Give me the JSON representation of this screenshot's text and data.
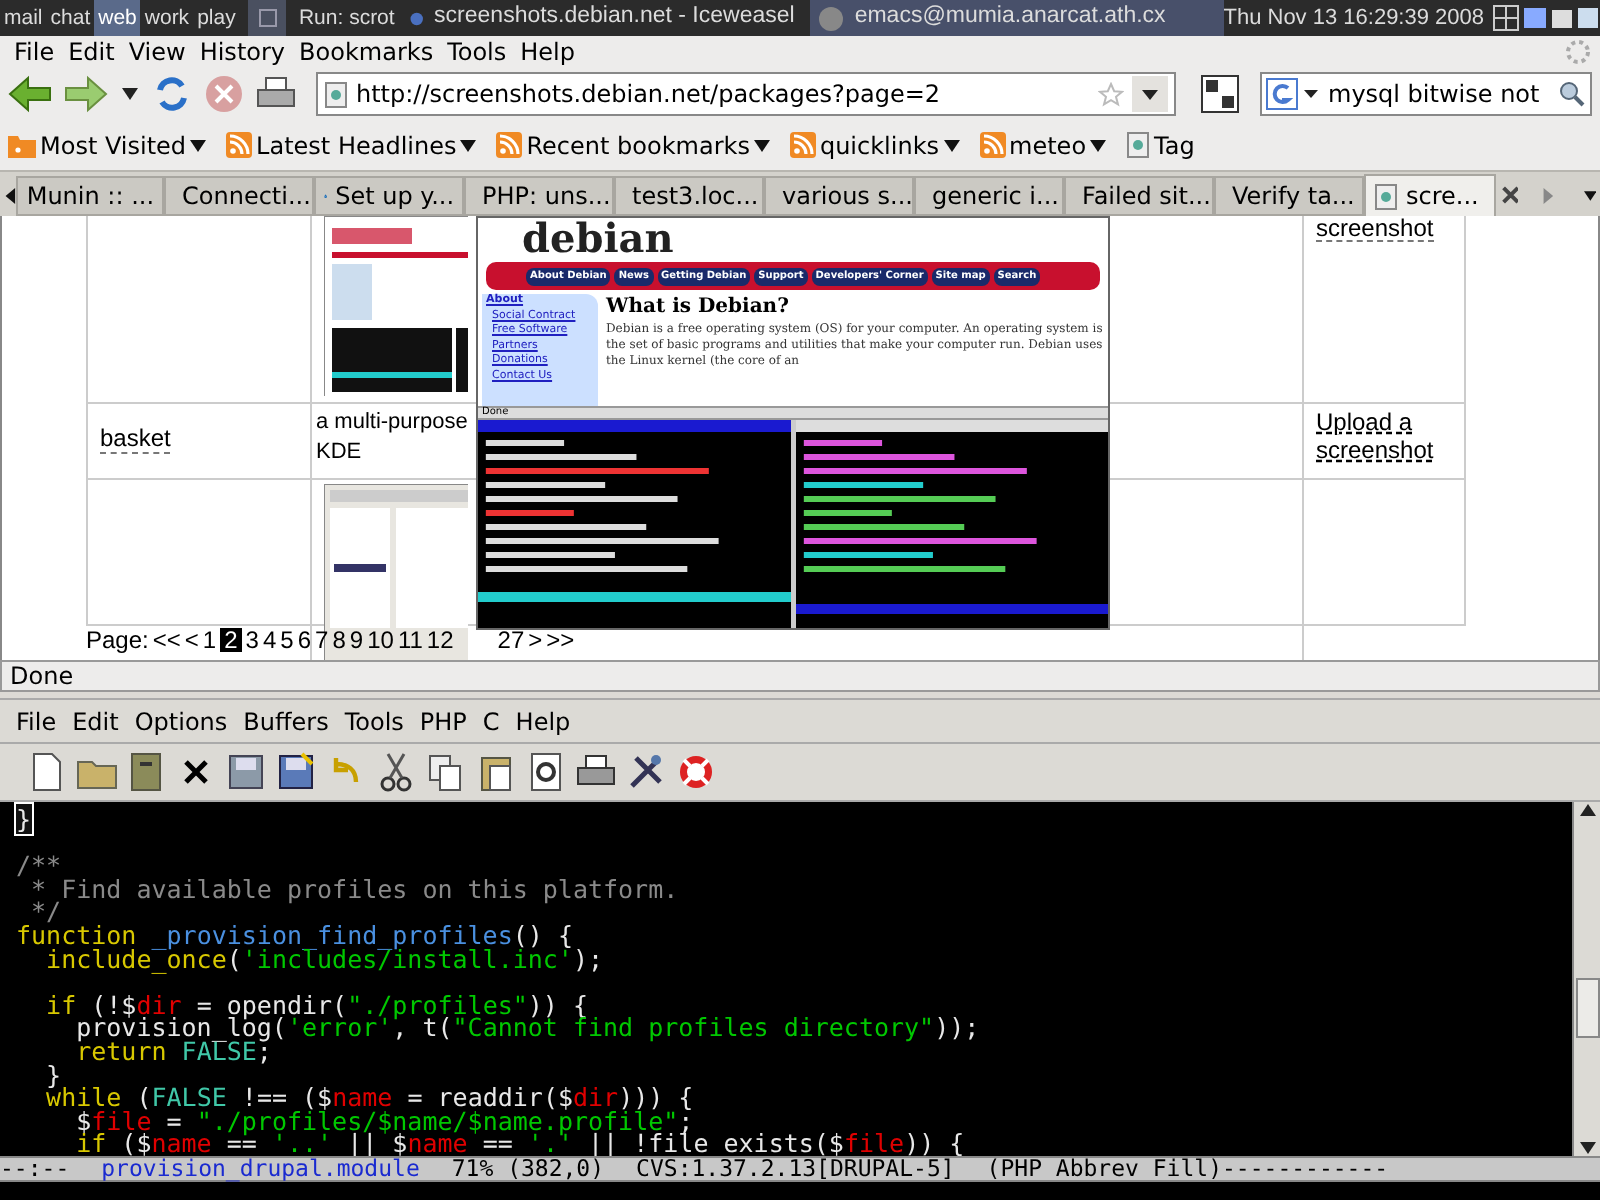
{
  "panel": {
    "workspaces": [
      {
        "label": "mail",
        "selected": false
      },
      {
        "label": "chat",
        "selected": false
      },
      {
        "label": "web",
        "selected": true
      },
      {
        "label": "work",
        "selected": false
      },
      {
        "label": "play",
        "selected": false
      }
    ],
    "run_label": "Run: scrot",
    "tasks": [
      {
        "label": "screenshots.debian.net - Iceweasel",
        "selected": false
      },
      {
        "label": "emacs@mumia.anarcat.ath.cx",
        "selected": true
      }
    ],
    "clock": "Thu Nov 13 16:29:39 2008"
  },
  "browser": {
    "menu": [
      "File",
      "Edit",
      "View",
      "History",
      "Bookmarks",
      "Tools",
      "Help"
    ],
    "url": "http://screenshots.debian.net/packages?page=2",
    "search": "mysql bitwise not",
    "bookmarks": [
      {
        "label": "Most Visited",
        "kind": "folder"
      },
      {
        "label": "Latest Headlines",
        "kind": "feed"
      },
      {
        "label": "Recent bookmarks",
        "kind": "feed"
      },
      {
        "label": "quicklinks",
        "kind": "feed"
      },
      {
        "label": "meteo",
        "kind": "feed"
      },
      {
        "label": "Tag",
        "kind": "page"
      }
    ],
    "tabs": [
      {
        "label": "Munin :: ...",
        "selected": false,
        "kind": "plain"
      },
      {
        "label": "Connecti...",
        "selected": false,
        "kind": "page"
      },
      {
        "label": "Set up y...",
        "selected": false,
        "kind": "drop"
      },
      {
        "label": "PHP: uns...",
        "selected": false,
        "kind": "php"
      },
      {
        "label": "test3.loc...",
        "selected": false,
        "kind": "drop"
      },
      {
        "label": "various s...",
        "selected": false,
        "kind": "drop"
      },
      {
        "label": "generic i...",
        "selected": false,
        "kind": "drop"
      },
      {
        "label": "Failed sit...",
        "selected": false,
        "kind": "drop"
      },
      {
        "label": "Verify ta...",
        "selected": false,
        "kind": "drop"
      },
      {
        "label": "scre...",
        "selected": true,
        "kind": "page"
      }
    ],
    "page": {
      "top_right_cell": "screenshot",
      "rows": [
        {
          "name": "basket",
          "description": "a multi-purpose",
          "description_2": "KDE",
          "action": "Upload a screenshot"
        }
      ],
      "page_label": "Page:",
      "first": "<<",
      "prev": "<",
      "pages": [
        {
          "label": "1",
          "selected": false
        },
        {
          "label": "2",
          "selected": true
        },
        {
          "label": "3",
          "selected": false
        },
        {
          "label": "4",
          "selected": false
        },
        {
          "label": "5",
          "selected": false
        },
        {
          "label": "6",
          "selected": false
        },
        {
          "label": "7",
          "selected": false
        },
        {
          "label": "8",
          "selected": false
        },
        {
          "label": "9",
          "selected": false
        },
        {
          "label": "10",
          "selected": false
        },
        {
          "label": "11",
          "selected": false
        },
        {
          "label": "12",
          "selected": false
        },
        {
          "label": "27",
          "selected": false
        }
      ],
      "next": ">",
      "last": ">>"
    },
    "preview": {
      "logo": "debian",
      "nav": [
        "About Debian",
        "News",
        "Getting Debian",
        "Support",
        "Developers' Corner",
        "Site map",
        "Search"
      ],
      "sidebar": [
        "About",
        "Social Contract",
        "Free Software",
        "Partners",
        "Donations",
        "Contact Us"
      ],
      "heading": "What is Debian?",
      "text": "Debian is a free operating system (OS) for your computer. An operating system is the set of basic programs and utilities that make your computer run. Debian uses the Linux kernel (the core of an",
      "status": "Done"
    },
    "status": "Done"
  },
  "emacs": {
    "menu": [
      "File",
      "Edit",
      "Options",
      "Buffers",
      "Tools",
      "PHP",
      "C",
      "Help"
    ],
    "lines": [
      {
        "tokens": [
          {
            "text": "}",
            "kind": "cursor"
          }
        ]
      },
      {
        "space_before": true,
        "tokens": [
          {
            "text": "/**",
            "kind": "comment"
          }
        ]
      },
      {
        "tokens": [
          {
            "text": " * Find available profiles on this platform.",
            "kind": "comment"
          }
        ]
      },
      {
        "tokens": [
          {
            "text": " */",
            "kind": "comment"
          }
        ]
      },
      {
        "tokens": [
          {
            "text": "function",
            "kind": "keyword"
          },
          {
            "text": " _provision_find_profiles",
            "kind": "function"
          },
          {
            "text": "() {",
            "kind": "plain"
          }
        ]
      },
      {
        "tokens": [
          {
            "text": "  include_once",
            "kind": "keyword"
          },
          {
            "text": "(",
            "kind": "plain"
          },
          {
            "text": "'includes/install.inc'",
            "kind": "string"
          },
          {
            "text": ");",
            "kind": "plain"
          }
        ]
      },
      {
        "space_before": true,
        "tokens": [
          {
            "text": "  if",
            "kind": "keyword"
          },
          {
            "text": " (!$",
            "kind": "plain"
          },
          {
            "text": "dir",
            "kind": "variable"
          },
          {
            "text": " = opendir(",
            "kind": "plain"
          },
          {
            "text": "\"./profiles\"",
            "kind": "string"
          },
          {
            "text": ")) {",
            "kind": "plain"
          }
        ]
      },
      {
        "tokens": [
          {
            "text": "    provision_log(",
            "kind": "plain"
          },
          {
            "text": "'error'",
            "kind": "string"
          },
          {
            "text": ", t(",
            "kind": "plain"
          },
          {
            "text": "\"Cannot find profiles directory\"",
            "kind": "string"
          },
          {
            "text": "));",
            "kind": "plain"
          }
        ]
      },
      {
        "tokens": [
          {
            "text": "    return",
            "kind": "keyword"
          },
          {
            "text": " FALSE",
            "kind": "constant"
          },
          {
            "text": ";",
            "kind": "plain"
          }
        ]
      },
      {
        "tokens": [
          {
            "text": "  }",
            "kind": "plain"
          }
        ]
      },
      {
        "tokens": [
          {
            "text": "  while",
            "kind": "keyword"
          },
          {
            "text": " (",
            "kind": "plain"
          },
          {
            "text": "FALSE",
            "kind": "constant"
          },
          {
            "text": " !== ($",
            "kind": "plain"
          },
          {
            "text": "name",
            "kind": "variable"
          },
          {
            "text": " = readdir($",
            "kind": "plain"
          },
          {
            "text": "dir",
            "kind": "variable"
          },
          {
            "text": "))) {",
            "kind": "plain"
          }
        ]
      },
      {
        "tokens": [
          {
            "text": "    $",
            "kind": "plain"
          },
          {
            "text": "file",
            "kind": "variable"
          },
          {
            "text": " = ",
            "kind": "plain"
          },
          {
            "text": "\"./profiles/$name/$name.profile\"",
            "kind": "string"
          },
          {
            "text": ";",
            "kind": "plain"
          }
        ]
      },
      {
        "tokens": [
          {
            "text": "    if",
            "kind": "keyword"
          },
          {
            "text": " ($",
            "kind": "plain"
          },
          {
            "text": "name",
            "kind": "variable"
          },
          {
            "text": " == ",
            "kind": "plain"
          },
          {
            "text": "'..'",
            "kind": "string"
          },
          {
            "text": " || $",
            "kind": "plain"
          },
          {
            "text": "name",
            "kind": "variable"
          },
          {
            "text": " == ",
            "kind": "plain"
          },
          {
            "text": "'.'",
            "kind": "string"
          },
          {
            "text": " || !file_exists($",
            "kind": "plain"
          },
          {
            "text": "file",
            "kind": "variable"
          },
          {
            "text": ")) {",
            "kind": "plain"
          }
        ]
      }
    ],
    "modeline": {
      "flags": "--:--",
      "buffer": "provision_drupal.module",
      "position": "71% (382,0)",
      "vc": "CVS:1.37.2.13[DRUPAL-5]",
      "modes": "(PHP Abbrev Fill)------------"
    }
  }
}
